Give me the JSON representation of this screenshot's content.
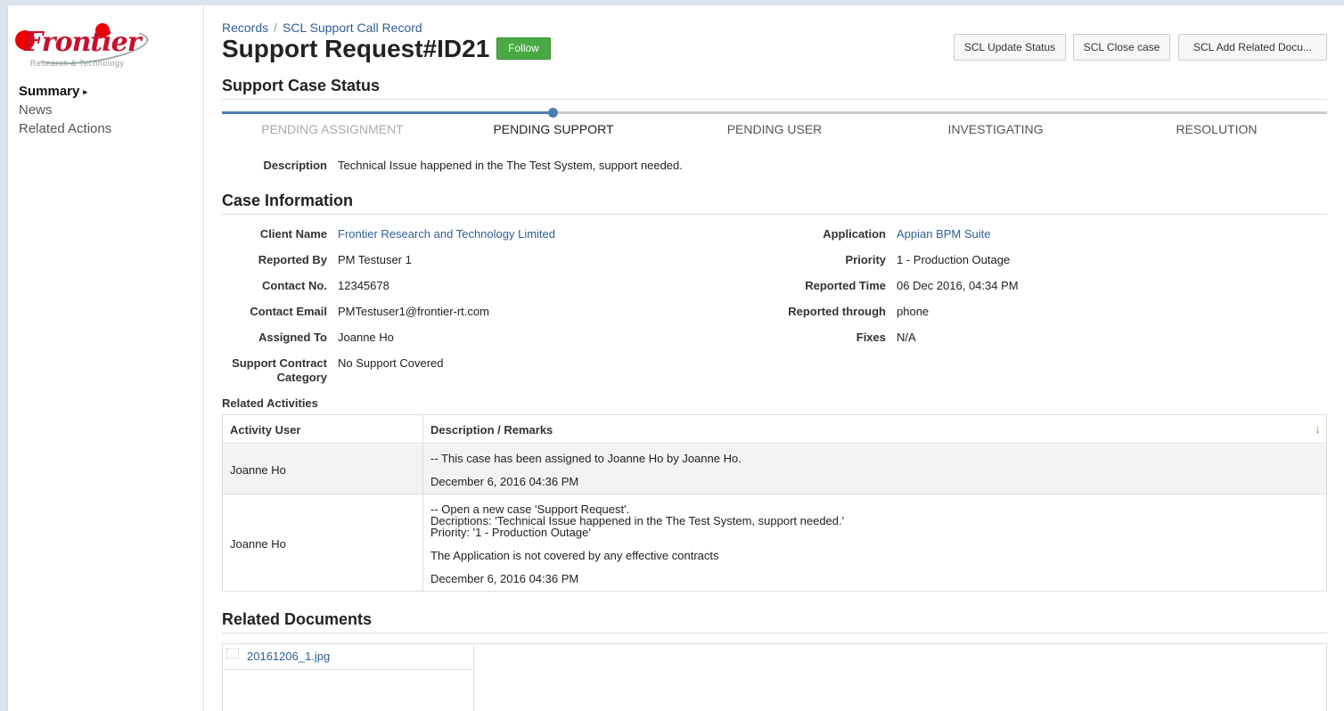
{
  "brand": {
    "logo_name": "Frontier",
    "logo_tagline": "Research & Technology"
  },
  "sidebar": {
    "items": [
      {
        "label": "Summary",
        "active": true
      },
      {
        "label": "News"
      },
      {
        "label": "Related Actions"
      }
    ]
  },
  "breadcrumb": {
    "root": "Records",
    "current": "SCL Support Call Record",
    "separator": "/"
  },
  "header": {
    "title": "Support Request#ID21",
    "follow_label": "Follow",
    "actions": [
      "SCL Update Status",
      "SCL Close case",
      "SCL Add Related Docu..."
    ]
  },
  "status": {
    "heading": "Support Case Status",
    "steps": [
      "PENDING ASSIGNMENT",
      "PENDING SUPPORT",
      "PENDING USER",
      "INVESTIGATING",
      "RESOLUTION"
    ],
    "current_step_index": 1,
    "description_label": "Description",
    "description": "Technical Issue happened in the The Test System, support needed."
  },
  "case_info": {
    "heading": "Case Information",
    "left": [
      {
        "label": "Client Name",
        "value": "Frontier Research and Technology Limited",
        "link": true
      },
      {
        "label": "Reported By",
        "value": "PM Testuser 1"
      },
      {
        "label": "Contact No.",
        "value": "12345678"
      },
      {
        "label": "Contact Email",
        "value": "PMTestuser1@frontier-rt.com"
      },
      {
        "label": "Assigned To",
        "value": "Joanne Ho"
      },
      {
        "label_line1": "Support Contract",
        "label_line2": "Category",
        "value": "No Support Covered"
      }
    ],
    "right": [
      {
        "label": "Application",
        "value": "Appian BPM Suite",
        "link": true
      },
      {
        "label": "Priority",
        "value": "1 - Production Outage"
      },
      {
        "label": "Reported Time",
        "value": "06 Dec 2016, 04:34 PM"
      },
      {
        "label": "Reported through",
        "value": "phone"
      },
      {
        "label": "Fixes",
        "value": "N/A"
      }
    ]
  },
  "activities": {
    "heading": "Related Activities",
    "columns": [
      "Activity User",
      "Description / Remarks"
    ],
    "sort_icon": "arrow-down-icon",
    "rows": [
      {
        "user": "Joanne Ho",
        "lines": [
          "-- This case has been assigned to Joanne Ho by Joanne Ho."
        ],
        "timestamp": "December 6, 2016 04:36 PM"
      },
      {
        "user": "Joanne Ho",
        "lines": [
          "-- Open a new case 'Support Request'.",
          "Decriptions: 'Technical Issue happened in the The Test System, support needed.'",
          "Priority: '1 - Production Outage'"
        ],
        "note": "The Application is not covered by any effective contracts",
        "timestamp": "December 6, 2016 04:36 PM"
      }
    ]
  },
  "documents": {
    "heading": "Related Documents",
    "files": [
      {
        "name": "20161206_1.jpg"
      }
    ]
  },
  "colors": {
    "link": "#2d5f96",
    "accent": "#4a7eb0",
    "follow": "#49a943",
    "sort_arrow": "#e07b1c"
  }
}
